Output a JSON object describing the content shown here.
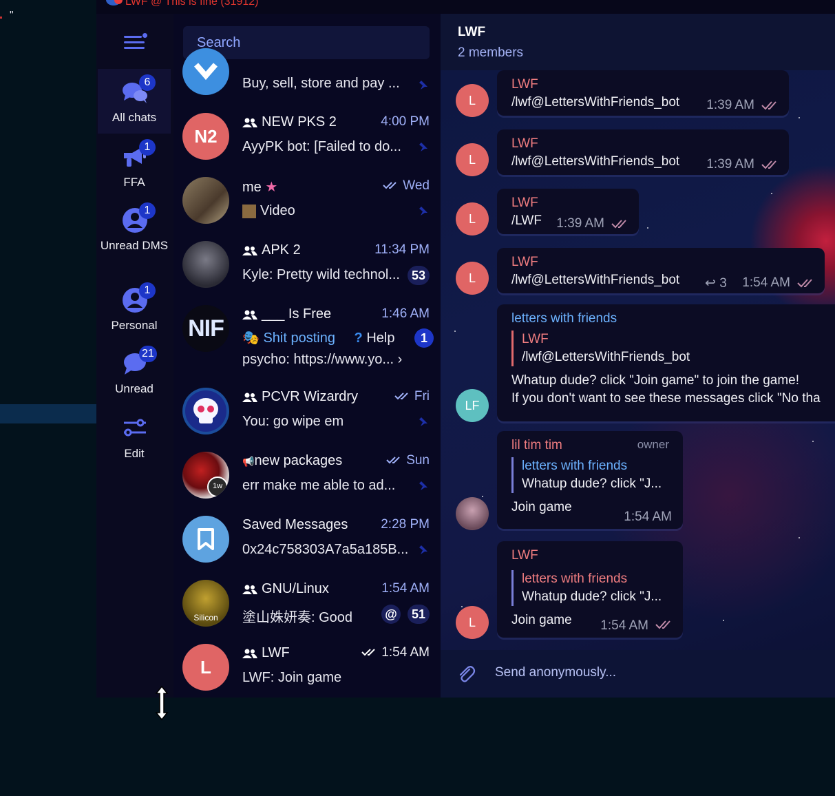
{
  "window": {
    "title": "LWF @ This is fine (31912)"
  },
  "folders": {
    "items": [
      {
        "label": "All chats",
        "badge": "6",
        "icon": "chats-icon",
        "active": true
      },
      {
        "label": "FFA",
        "badge": "1",
        "icon": "megaphone-icon"
      },
      {
        "label": "Unread DMS",
        "badge": "1",
        "icon": "user-icon"
      },
      {
        "label": "Personal",
        "badge": "1",
        "icon": "user-icon"
      },
      {
        "label": "Unread",
        "badge": "21",
        "icon": "chat-bubble-icon"
      },
      {
        "label": "Edit",
        "badge": "",
        "icon": "sliders-icon"
      }
    ]
  },
  "search": {
    "placeholder": "Search"
  },
  "chats": [
    {
      "name": "",
      "time": "",
      "message": "Buy, sell, store and pay ...",
      "avatar_color": "#3d8fe0"
    },
    {
      "name": "NEW PKS 2",
      "time": "4:00 PM",
      "message": "AyyPK bot: [Failed to do...",
      "avatar_text": "N2",
      "avatar_color": "#e06565"
    },
    {
      "name": "me",
      "time": "Wed",
      "message": "Video",
      "avatar_color": "#6b5a48"
    },
    {
      "name": "APK 2",
      "time": "11:34 PM",
      "message": "Kyle: Pretty wild technol...",
      "unread": "53",
      "avatar_color": "#3a3a44"
    },
    {
      "name": "___ Is Free",
      "time": "1:46 AM",
      "topic1": "Shit posting",
      "topic2": "Help",
      "topic_badge": "1",
      "message": "psycho: https://www.yo...",
      "avatar_text": "NIF",
      "avatar_color": "#0a0a14"
    },
    {
      "name": "PCVR Wizardry",
      "time": "Fri",
      "message": "You: go wipe em",
      "avatar_color": "#1b4d9c"
    },
    {
      "name": "new packages",
      "time": "Sun",
      "message": "err make me able to ad...",
      "avatar_color": "#7a1a1a",
      "avatar_sub": "1w"
    },
    {
      "name": "Saved Messages",
      "time": "2:28 PM",
      "message": "0x24c758303A7a5a185B...",
      "avatar_color": "#5ea3e0"
    },
    {
      "name": "GNU/Linux",
      "time": "1:54 AM",
      "message": "塗山姝妍奏: Good",
      "unread": "51",
      "avatar_color": "#5a4a10",
      "avatar_sub": "Silicon"
    },
    {
      "name": "LWF",
      "time": "1:54 AM",
      "message": "LWF: Join game",
      "avatar_text": "L",
      "avatar_color": "#e06565"
    }
  ],
  "pane": {
    "title": "LWF",
    "members": "2 members",
    "composer_placeholder": "Send anonymously..."
  },
  "messages": [
    {
      "avatar": "L",
      "sender": "LWF",
      "text": "/lwf@LettersWithFriends_bot",
      "time": "1:39 AM"
    },
    {
      "avatar": "L",
      "sender": "LWF",
      "text": "/lwf@LettersWithFriends_bot",
      "time": "1:39 AM"
    },
    {
      "avatar": "L",
      "sender": "LWF",
      "text": "/LWF",
      "time": "1:39 AM"
    },
    {
      "avatar": "L",
      "sender": "LWF",
      "text": "/lwf@LettersWithFriends_bot",
      "time": "1:54 AM",
      "replies": "3"
    },
    {
      "avatar": "LF",
      "sender": "letters with friends",
      "quote_name": "LWF",
      "quote_text": "/lwf@LettersWithFriends_bot",
      "line1": "Whatup dude? click \"Join game\" to join the game!",
      "line2": "If you don't want to see these messages click \"No tha"
    },
    {
      "sender": "lil tim tim",
      "role": "owner",
      "quote_name": "letters with friends",
      "quote_text": "Whatup dude? click \"J...",
      "text": "Join game",
      "time": "1:54 AM"
    },
    {
      "avatar": "L",
      "sender": "LWF",
      "quote_name": "letters with friends",
      "quote_text": "Whatup dude? click \"J...",
      "text": "Join game",
      "time": "1:54 AM"
    }
  ],
  "colors": {
    "accent": "#5b6cf0",
    "badge": "#1d36c8",
    "avatar_red": "#e06565",
    "link_blue": "#6cb2ff"
  }
}
